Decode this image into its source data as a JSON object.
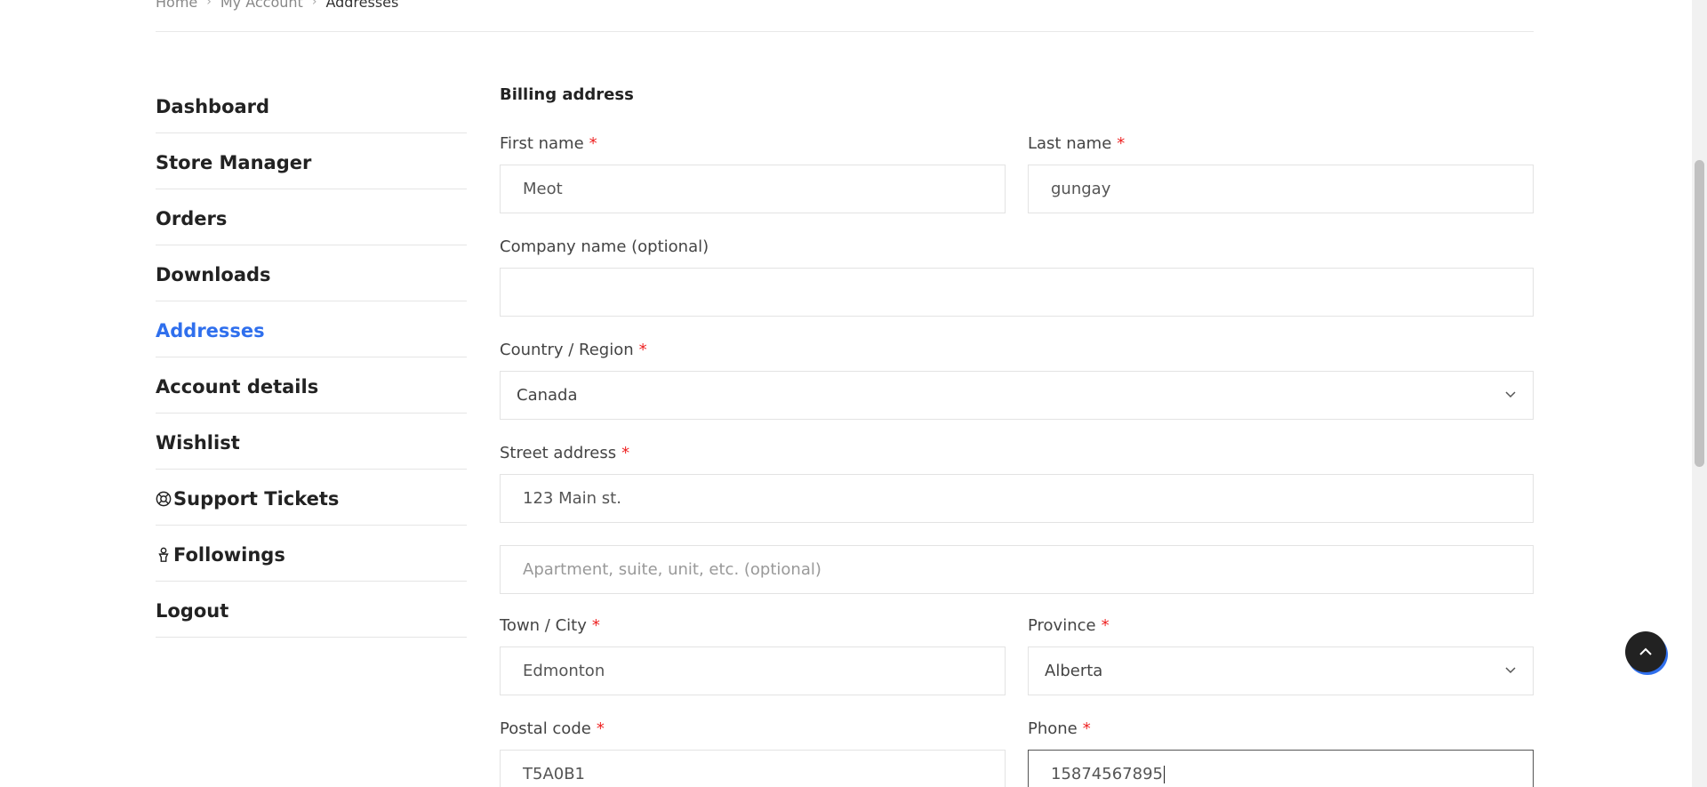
{
  "breadcrumb": {
    "items": [
      "Home",
      "My Account"
    ],
    "current": "Addresses"
  },
  "sidebar": {
    "items": [
      {
        "label": "Dashboard"
      },
      {
        "label": "Store Manager"
      },
      {
        "label": "Orders"
      },
      {
        "label": "Downloads"
      },
      {
        "label": "Addresses",
        "active": true
      },
      {
        "label": "Account details"
      },
      {
        "label": "Wishlist"
      },
      {
        "label": "Support Tickets",
        "icon": "lifebuoy-icon"
      },
      {
        "label": "Followings",
        "icon": "person-icon"
      },
      {
        "label": "Logout"
      }
    ]
  },
  "form": {
    "title": "Billing address",
    "first_name": {
      "label": "First name",
      "value": "Meot"
    },
    "last_name": {
      "label": "Last name",
      "value": "gungay"
    },
    "company": {
      "label": "Company name (optional)",
      "value": ""
    },
    "country": {
      "label": "Country / Region",
      "value": "Canada"
    },
    "street": {
      "label": "Street address",
      "value": "123 Main st.",
      "placeholder2": "Apartment, suite, unit, etc. (optional)"
    },
    "city": {
      "label": "Town / City",
      "value": "Edmonton"
    },
    "province": {
      "label": "Province",
      "value": "Alberta"
    },
    "postal": {
      "label": "Postal code",
      "value": "T5A0B1"
    },
    "phone": {
      "label": "Phone",
      "value": "15874567895"
    },
    "required_mark": "*"
  },
  "colors": {
    "accent": "#2f6fed",
    "required": "#ee2222"
  }
}
